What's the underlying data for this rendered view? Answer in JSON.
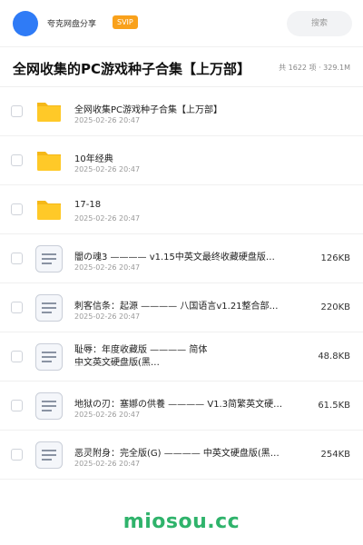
{
  "header": {
    "share_name": "夸克网盘分享",
    "badge": "SVIP",
    "search_label": "搜索"
  },
  "title": {
    "text": "全网收集的PC游戏种子合集【上万部】",
    "summary": "共 1622 项 · 329.1M"
  },
  "colors": {
    "accent": "#2f7bf6",
    "badge": "#f9a11b",
    "folder": "#ffc928",
    "watermark": "#2fb36b"
  },
  "items": [
    {
      "type": "folder",
      "icon": "folder-icon",
      "name": "全网收集PC游戏种子合集【上万部】",
      "date": "2025-02-26 20:47",
      "size": ""
    },
    {
      "type": "folder",
      "icon": "folder-icon",
      "name": "10年经典",
      "date": "2025-02-26 20:47",
      "size": ""
    },
    {
      "type": "folder",
      "icon": "folder-icon",
      "name": "17-18",
      "date": "2025-02-26 20:47",
      "size": ""
    },
    {
      "type": "file",
      "icon": "document-icon",
      "name": "闇の魂3 ———— v1.15中英文最终收藏硬盘版…",
      "date": "2025-02-26 20:47",
      "size": "126KB"
    },
    {
      "type": "file",
      "icon": "document-icon",
      "name": "刺客信条：起源 ———— 八国语言v1.21整合部…",
      "date": "2025-02-26 20:47",
      "size": "220KB"
    },
    {
      "type": "file",
      "icon": "document-icon",
      "name": "耻辱：年度收藏版 ———— 简体中文英文硬盘版(黑…",
      "date": "2025-02-26 20:47",
      "size": "48.8KB"
    },
    {
      "type": "file",
      "icon": "document-icon",
      "name": "地狱の刃：塞娜の供養 ———— V1.3简繁英文硬…",
      "date": "2025-02-26 20:47",
      "size": "61.5KB"
    },
    {
      "type": "file",
      "icon": "document-icon",
      "name": "恶灵附身：完全版(G) ———— 中英文硬盘版(黑…",
      "date": "2025-02-26 20:47",
      "size": "254KB"
    }
  ],
  "watermark": "miosou.cc"
}
